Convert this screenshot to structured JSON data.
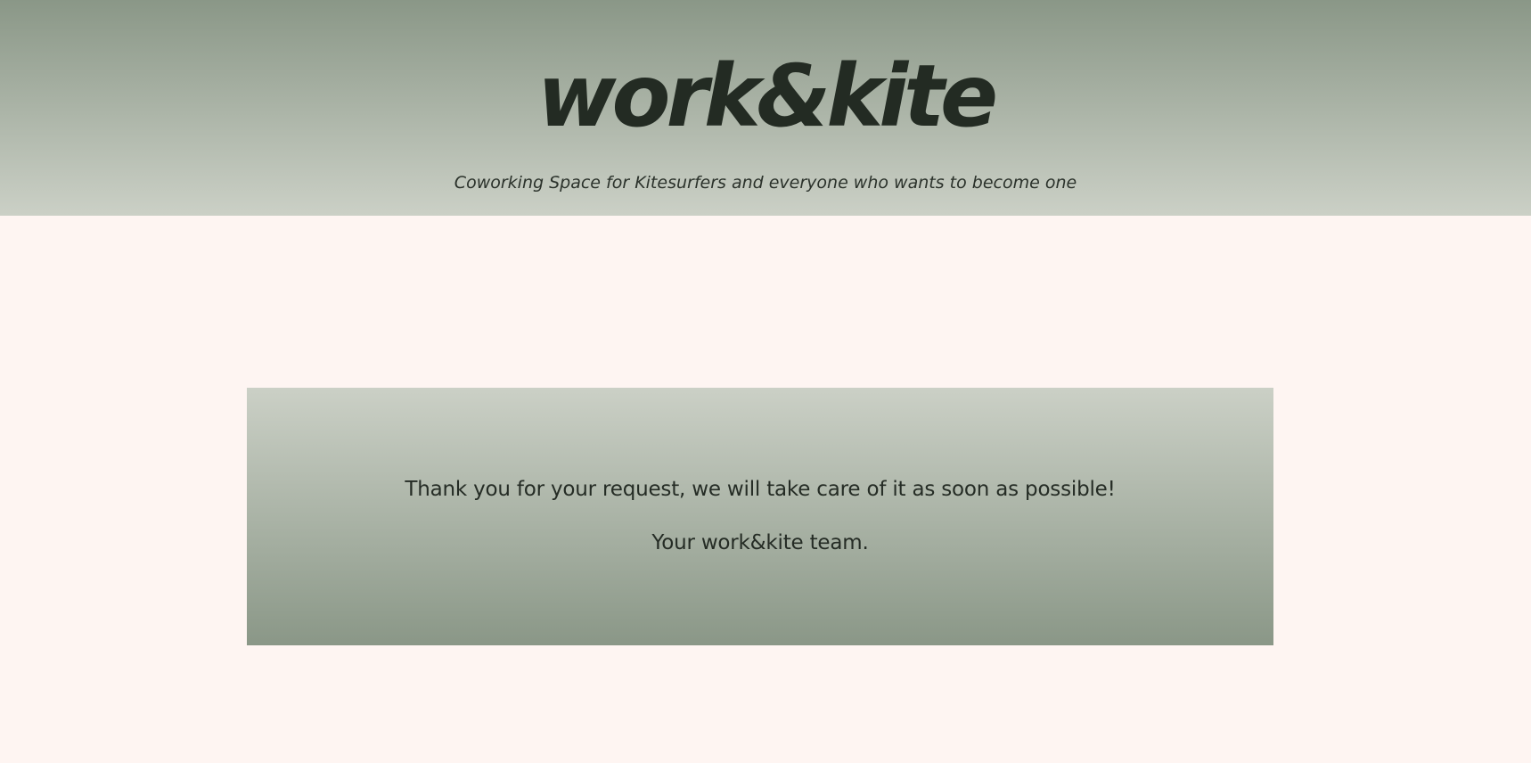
{
  "header": {
    "logo": "work&kite",
    "tagline": "Coworking Space for Kitesurfers and everyone who wants to become one"
  },
  "message": {
    "thank_you": "Thank you for your request, we will take care of it as soon as possible!",
    "signature": "Your work&kite team."
  },
  "colors": {
    "background": "#fef5f2",
    "sage_dark": "#8a9787",
    "sage_light": "#cbd0c6",
    "text": "#252c25"
  }
}
